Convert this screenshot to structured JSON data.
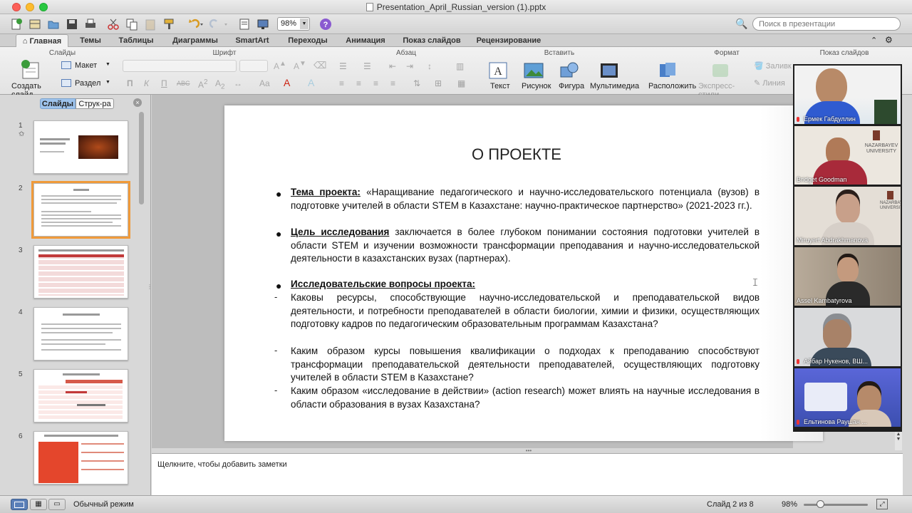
{
  "window": {
    "title": "Presentation_April_Russian_version (1).pptx"
  },
  "toolbar": {
    "zoom": "98%",
    "search_placeholder": "Поиск в презентации"
  },
  "tabs": [
    {
      "label": "Главная",
      "active": true
    },
    {
      "label": "Темы"
    },
    {
      "label": "Таблицы"
    },
    {
      "label": "Диаграммы"
    },
    {
      "label": "SmartArt"
    },
    {
      "label": "Переходы"
    },
    {
      "label": "Анимация"
    },
    {
      "label": "Показ слайдов"
    },
    {
      "label": "Рецензирование"
    }
  ],
  "ribbon": {
    "groups": {
      "slides": "Слайды",
      "font": "Шрифт",
      "paragraph": "Абзац",
      "insert": "Вставить",
      "format": "Формат",
      "slideshow": "Показ слайдов"
    },
    "new_slide": "Создать слайд",
    "layout": "Макет",
    "section": "Раздел",
    "insert_text": "Текст",
    "insert_picture": "Рисунок",
    "insert_shape": "Фигура",
    "insert_media": "Мультимедиа",
    "arrange": "Расположить",
    "quick_styles": "Экспресс-стили",
    "fill": "Заливк",
    "line": "Линия"
  },
  "sidebar": {
    "seg_slides": "Слайды",
    "seg_outline": "Струк-ра",
    "thumbs": [
      {
        "n": "1",
        "star": "✩"
      },
      {
        "n": "2"
      },
      {
        "n": "3"
      },
      {
        "n": "4"
      },
      {
        "n": "5"
      },
      {
        "n": "6"
      }
    ]
  },
  "slide": {
    "title": "О ПРОЕКТЕ",
    "b1_label": "Тема проекта:",
    "b1_text": " «Наращивание педагогического и научно-исследовательского потенциала (вузов) в подготовке учителей в области STEM в Казахстане: научно-практическое партнерство» (2021-2023 гг.).",
    "b2_label": "Цель исследования",
    "b2_text": " заключается в более глубоком понимании состояния подготовки учителей в области STEM и изучении возможности трансформации преподавания и научно-исследовательской деятельности в казахстанских вузах (партнерах).",
    "b3_label": "Исследовательские вопросы проекта:",
    "q1": "Каковы ресурсы, способствующие научно-исследовательской и преподавательской видов деятельности, и потребности преподавателей в области биологии, химии и физики, осуществляющих подготовку кадров по педагогическим образовательным программам Казахстана?",
    "q2": "Каким образом курсы повышения квалификации о подходах к преподаванию способствуют трансформации преподавательской деятельности преподавателей, осуществляющих подготовку учителей в области STEM в Казахстане?",
    "q3": "Каким образом «исследование в действии» (action research) может влиять на научные исследования в области образования в вузах Казахстана?",
    "dash": "-",
    "bullet": "●"
  },
  "notes": {
    "placeholder": "Щелкните, чтобы добавить заметки"
  },
  "status": {
    "mode": "Обычный режим",
    "slide_counter": "Слайд 2 из 8",
    "zoom": "98%"
  },
  "participants": [
    {
      "name": "Ермек Габдуллин",
      "color": "#3d5a7a"
    },
    {
      "name": "Bridget Goodman",
      "color": "#8a6a4a"
    },
    {
      "name": "Miruyert Abdrakhmanova",
      "color": "#c9c2bb"
    },
    {
      "name": "Assel Kambatyrova",
      "color": "#9a8e80"
    },
    {
      "name": "Айбар Нукенов, ВШ...",
      "color": "#8b8f96"
    },
    {
      "name": "Ельтинова Раушан ...",
      "color": "#3c4fb0"
    }
  ],
  "nazarbayev": "NAZARBAYEV UNIVERSITY"
}
